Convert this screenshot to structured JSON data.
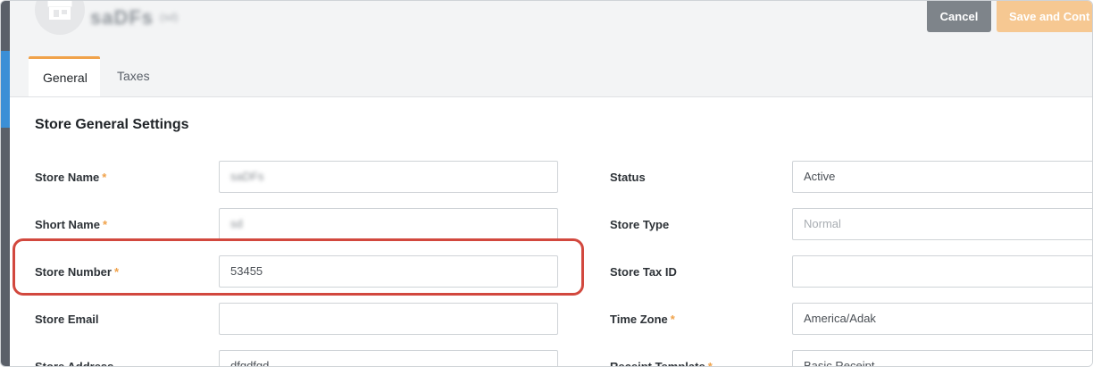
{
  "header": {
    "store_name": "saDFs",
    "store_name_tag": "(sd)",
    "cancel_label": "Cancel",
    "save_label": "Save and Cont"
  },
  "tabs": [
    {
      "label": "General",
      "active": true
    },
    {
      "label": "Taxes",
      "active": false
    }
  ],
  "section": {
    "title": "Store General Settings"
  },
  "left_fields": [
    {
      "label": "Store Name",
      "required": "*",
      "value": "saDFs"
    },
    {
      "label": "Short Name",
      "required": "*",
      "value": "sd"
    },
    {
      "label": "Store Number",
      "required": "*",
      "value": "53455"
    },
    {
      "label": "Store Email",
      "required": "",
      "value": ""
    },
    {
      "label": "Store Address",
      "required": "",
      "value": "dfgdfgd"
    }
  ],
  "right_fields": [
    {
      "label": "Status",
      "required": "",
      "value": "Active"
    },
    {
      "label": "Store Type",
      "required": "",
      "placeholder": "Normal"
    },
    {
      "label": "Store Tax ID",
      "required": "",
      "value": ""
    },
    {
      "label": "Time Zone",
      "required": "*",
      "value": "America/Adak"
    },
    {
      "label": "Receipt Template",
      "required": "*",
      "value": "Basic Receipt"
    }
  ],
  "colors": {
    "accent": "#f0a24a",
    "highlight": "#d2483e",
    "rail_accent": "#3b8fd6"
  }
}
